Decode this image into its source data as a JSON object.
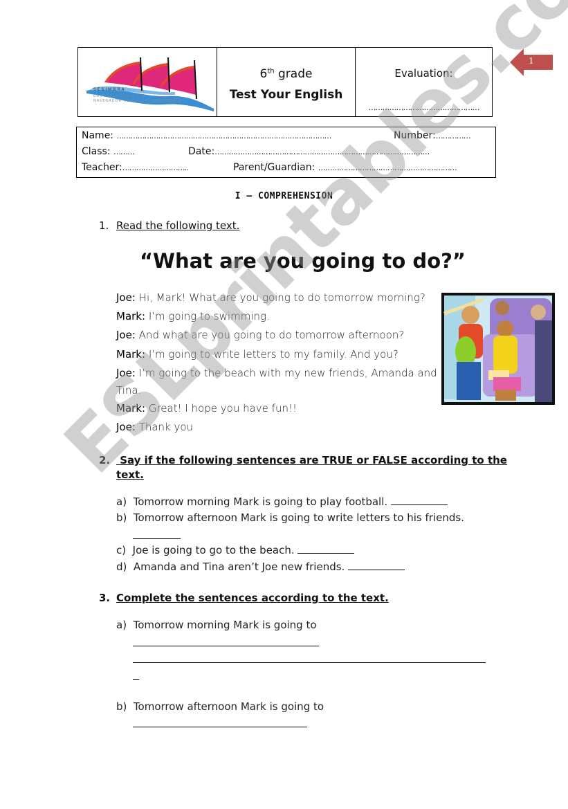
{
  "header": {
    "logo": {
      "school_town": "SESIMBRA",
      "school_line1": "ESCOLA BÁSICA 2,3",
      "school_line2": "NAVEGADOR RODRIGUES SOROMENHO"
    },
    "grade_number": "6",
    "grade_suffix": "th",
    "grade_word": "grade",
    "title": "Test Your English",
    "evaluation_label": "Evaluation:",
    "evaluation_dots": "…………………………………………"
  },
  "page_badge": {
    "number": "1",
    "color": "#c0504d"
  },
  "info": {
    "name_label": "Name:",
    "name_dots": "…………………………………………………………………………………",
    "number_label": "Number:",
    "number_dots": "……………",
    "class_label": "Class:",
    "class_dots": "………",
    "date_label": "Date:",
    "date_dots": "…………………………………………………………………………………",
    "teacher_label": "Teacher:",
    "teacher_dots": "………………………..",
    "parent_label": "Parent/Guardian:",
    "parent_dots": "……………………………………………………"
  },
  "section_title": "I – COMPREHENSION",
  "q1": {
    "number": "1.",
    "heading": "Read the following text."
  },
  "story": {
    "title": "“What are you going to do?”",
    "lines": [
      {
        "speaker": "Joe:",
        "text": "Hi, Mark! What are you going to do tomorrow morning?"
      },
      {
        "speaker": "Mark:",
        "text": "I’m going to swimming."
      },
      {
        "speaker": "Joe:",
        "text": "And what are you going to do tomorrow afternoon?"
      },
      {
        "speaker": "Mark:",
        "text": "I’m going to write letters to my family. And you?"
      },
      {
        "speaker": "Joe:",
        "text": "I’m going to the beach with my new friends, Amanda and"
      },
      {
        "speaker": "",
        "text": "Tina."
      },
      {
        "speaker": "Mark:",
        "text": "Great! I hope you have fun!!"
      },
      {
        "speaker": "Joe:",
        "text": "Thank you"
      }
    ],
    "illustration": "students-on-bus-clipart"
  },
  "q2": {
    "number": "2.",
    "heading_line1": " Say if the following sentences are TRUE or FALSE according to the",
    "heading_line2": "text.",
    "items": [
      {
        "label": "a)",
        "text": "Tomorrow morning Mark is going to play football."
      },
      {
        "label": "b)",
        "text": "Tomorrow afternoon Mark is going to write letters to his friends."
      },
      {
        "label": "c)",
        "text": "Joe is going to go to the beach."
      },
      {
        "label": "d)",
        "text": "Amanda and Tina aren’t Joe new friends."
      }
    ]
  },
  "q3": {
    "number": "3.",
    "heading": "Complete the sentences according to the text.",
    "items": [
      {
        "label": "a)",
        "text": "Tomorrow morning Mark is going to"
      },
      {
        "label": "b)",
        "text": "Tomorrow afternoon Mark is going to"
      }
    ]
  },
  "watermark": "ESLprintables.com"
}
